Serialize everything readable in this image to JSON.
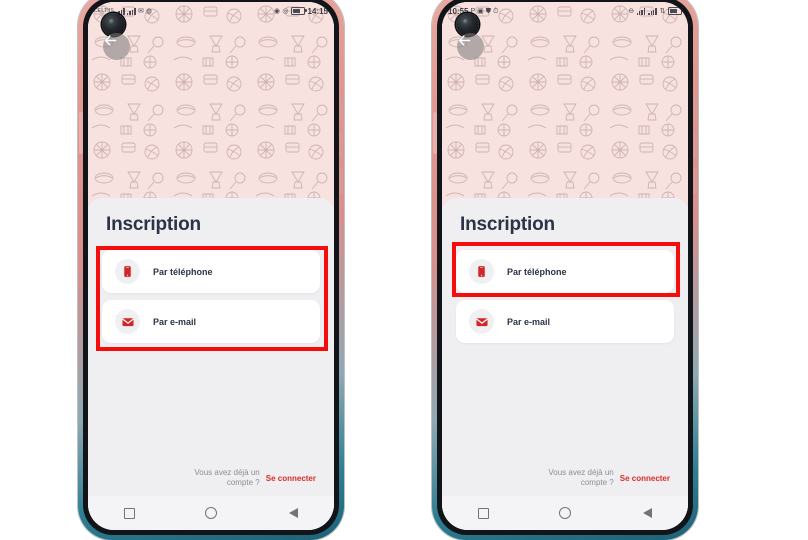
{
  "app": {
    "screen_title": "Inscription",
    "background_color": "#f7e2df",
    "sheet_color": "#efeff1",
    "accent_color": "#e02a25",
    "title_color": "#2b3445",
    "annotation_color": "#f40d0d"
  },
  "phones": [
    {
      "id": "left",
      "status_bar": {
        "carrier": "CELTIIS",
        "network": "4G",
        "icons": [
          "signal-bars-icon",
          "signal-bars-icon",
          "mail-icon",
          "whatsapp-icon",
          "alarm-icon",
          "mute-icon",
          "battery-icon"
        ],
        "time": "14:15"
      },
      "back_button": "back-arrow",
      "title": "Inscription",
      "options": [
        {
          "icon": "phone-icon",
          "label": "Par téléphone"
        },
        {
          "icon": "envelope-icon",
          "label": "Par e-mail"
        }
      ],
      "footer": {
        "question": "Vous avez déjà un compte ?",
        "link": "Se connecter"
      },
      "nav": [
        "recents-square",
        "home-circle",
        "back-triangle"
      ],
      "annotation": "highlight around both signup options"
    },
    {
      "id": "right",
      "status_bar": {
        "time": "10:55",
        "carrier": "",
        "icons": [
          "parking-p-icon",
          "screenshot-icon",
          "shield-icon",
          "alarm-icon",
          "mute-icon",
          "signal-bars-icon",
          "signal-bars-icon",
          "data-icon",
          "battery-icon"
        ],
        "time_right": ""
      },
      "back_button": "back-arrow",
      "title": "Inscription",
      "options": [
        {
          "icon": "phone-icon",
          "label": "Par téléphone"
        },
        {
          "icon": "envelope-icon",
          "label": "Par e-mail"
        }
      ],
      "footer": {
        "question": "Vous avez déjà un compte ?",
        "link": "Se connecter"
      },
      "nav": [
        "recents-square",
        "home-circle",
        "back-triangle"
      ],
      "annotation": "highlight around Par téléphone option only"
    }
  ]
}
